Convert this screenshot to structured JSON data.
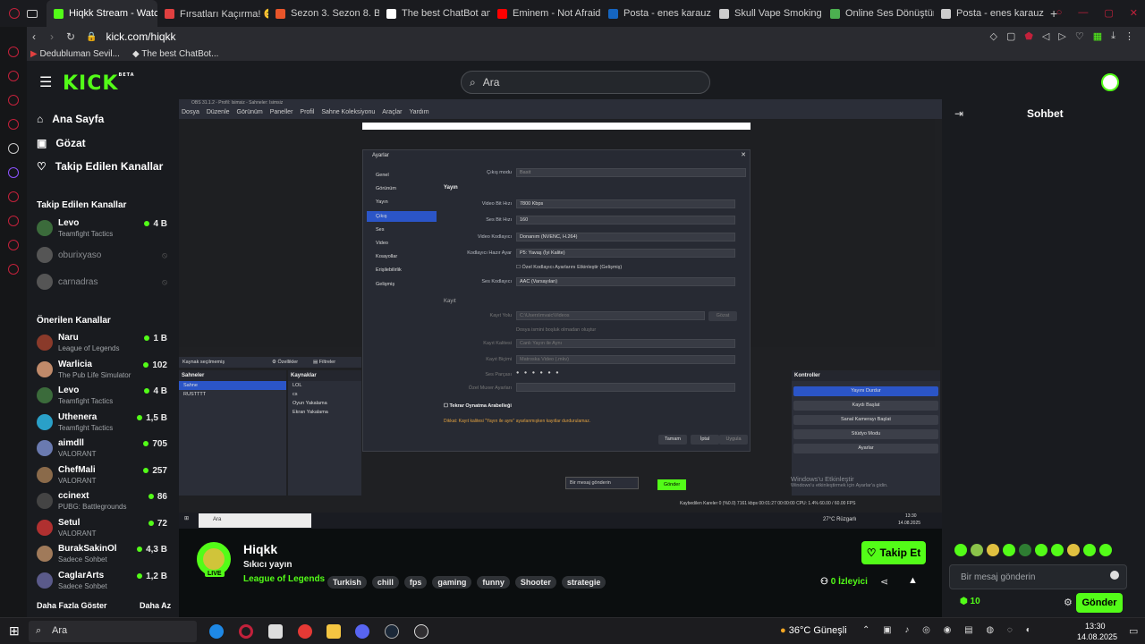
{
  "browser": {
    "tabs": [
      {
        "label": "Hiqkk Stream - Watch Live",
        "color": "#53fc18",
        "active": true
      },
      {
        "label": "Fırsatları Kaçırma! 😊",
        "color": "#e04040"
      },
      {
        "label": "Sezon 3. Sezon 8. Bölüm",
        "color": "#e8552a"
      },
      {
        "label": "The best ChatBot and W",
        "color": "#ffffff"
      },
      {
        "label": "Eminem - Not Afraid - Y",
        "color": "#ff0000"
      },
      {
        "label": "Posta - enes karauz - O",
        "color": "#1565c0"
      },
      {
        "label": "Skull Vape Smoking Log",
        "color": "#cccccc"
      },
      {
        "label": "Online Ses Dönüştürücü",
        "color": "#4caf50"
      },
      {
        "label": "Posta - enes karauz - O",
        "color": "#cccccc"
      }
    ],
    "url": "kick.com/hiqkk",
    "bookmarks": [
      "Dedubluman Sevil...",
      "The best ChatBot..."
    ]
  },
  "kick": {
    "logo": "KICK",
    "logo_badge": "BETA",
    "search_placeholder": "Ara",
    "nav": [
      {
        "label": "Ana Sayfa",
        "icon": "home-icon",
        "glyph": "⌂"
      },
      {
        "label": "Gözat",
        "icon": "browse-icon",
        "glyph": "▣"
      },
      {
        "label": "Takip Edilen Kanallar",
        "icon": "heart-icon",
        "glyph": "♡"
      }
    ],
    "followed_title": "Takip Edilen Kanallar",
    "followed": [
      {
        "name": "Levo",
        "game": "Teamfight Tactics",
        "viewers": "4 B",
        "color": "#3b6b3b"
      },
      {
        "name": "oburixyaso",
        "game": "",
        "viewers": "",
        "color": "#555",
        "offline": true
      },
      {
        "name": "carnadras",
        "game": "",
        "viewers": "",
        "color": "#555",
        "offline": true
      }
    ],
    "recommended_title": "Önerilen Kanallar",
    "recommended": [
      {
        "name": "Naru",
        "game": "League of Legends",
        "viewers": "1 B",
        "color": "#8a3a2a"
      },
      {
        "name": "Warlicia",
        "game": "The Pub Life Simulator",
        "viewers": "102",
        "color": "#c08a6a"
      },
      {
        "name": "Levo",
        "game": "Teamfight Tactics",
        "viewers": "4 B",
        "color": "#3b6b3b"
      },
      {
        "name": "Uthenera",
        "game": "Teamfight Tactics",
        "viewers": "1,5 B",
        "color": "#2aa0c8"
      },
      {
        "name": "aimdll",
        "game": "VALORANT",
        "viewers": "705",
        "color": "#6a7ab0"
      },
      {
        "name": "ChefMali",
        "game": "VALORANT",
        "viewers": "257",
        "color": "#8a6a4a"
      },
      {
        "name": "ccinext",
        "game": "PUBG: Battlegrounds",
        "viewers": "86",
        "color": "#444"
      },
      {
        "name": "Setul",
        "game": "VALORANT",
        "viewers": "72",
        "color": "#b03030"
      },
      {
        "name": "BurakSakinOl",
        "game": "Sadece Sohbet",
        "viewers": "4,3 B",
        "color": "#a07a5a"
      },
      {
        "name": "CaglarArts",
        "game": "Sadece Sohbet",
        "viewers": "1,2 B",
        "color": "#5a5a8a"
      }
    ],
    "show_more": "Daha Fazla Göster",
    "show_less": "Daha Az",
    "chat_title": "Sohbet",
    "chat_placeholder": "Bir mesaj gönderin",
    "chat_send": "Gönder",
    "chat_points": "10",
    "streamer": {
      "name": "Hiqkk",
      "title": "Sıkıcı yayın",
      "category": "League of Legends",
      "live_badge": "LIVE",
      "tags": [
        "Turkish",
        "chill",
        "fps",
        "gaming",
        "funny",
        "Shooter",
        "strategie"
      ],
      "viewers_count": "0",
      "viewers_label": "İzleyici",
      "follow_label": "Takip Et"
    }
  },
  "obs": {
    "title": "OBS 31.1.2 - Profil: Isimsiz - Sahneler: Isimsiz",
    "menu": [
      "Dosya",
      "Düzenle",
      "Görünüm",
      "Paneller",
      "Profil",
      "Sahne Koleksiyonu",
      "Araçlar",
      "Yardım"
    ],
    "settings_title": "Ayarlar",
    "settings_tabs": [
      "Genel",
      "Görünüm",
      "Yayın",
      "Çıkış",
      "Ses",
      "Video",
      "Kısayollar",
      "Erişilebilirlik",
      "Gelişmiş"
    ],
    "output_mode_label": "Çıkış modu",
    "output_mode_value": "Basit",
    "stream_section": "Yayın",
    "rows": [
      {
        "label": "Video Bit Hızı",
        "value": "7800 Kbps"
      },
      {
        "label": "Ses Bit Hızı",
        "value": "160"
      },
      {
        "label": "Video Kodlayıcı",
        "value": "Donanım (NVENC, H.264)"
      },
      {
        "label": "Kodlayıcı Hazır Ayar",
        "value": "P5: Yavaş (İyi Kalite)"
      },
      {
        "label": "Ses Kodlayıcı",
        "value": "AAC (Varsayılan)"
      }
    ],
    "custom_encoder": "Özel Kodlayıcı Ayarlarını Etkinleştir (Gelişmiş)",
    "record_section": "Kayıt",
    "record_path_label": "Kayıt Yolu",
    "record_path_value": "C:\\Users\\mvaic\\Videos",
    "browse": "Gözat",
    "no_space": "Dosya ismini boşluk olmadan oluştur",
    "record_quality_label": "Kayıt Kalitesi",
    "record_quality_value": "Canlı Yayın ile Aynı",
    "record_format_label": "Kayıt Biçimi",
    "record_format_value": "Matroska Video (.mkv)",
    "audio_track_label": "Ses Parçası",
    "custom_muxer_label": "Özel Muxer Ayarları",
    "replay_buffer": "Tekrar Oynatma Arabelleği",
    "warning": "Dikkat: Kayıt kalitesi \"Yayın ile aynı\" ayarlanmışken kayıtlar durdurulamaz.",
    "ok": "Tamam",
    "cancel": "İptal",
    "apply": "Uygula",
    "scenes_title": "Sahneler",
    "scenes": [
      "Sahne",
      "RUSTTTT"
    ],
    "sources_title": "Kaynaklar",
    "sources": [
      "LOL",
      "cs",
      "Oyun Yakalama",
      "Ekran Yakalama"
    ],
    "source_none": "Kaynak seçilmemiş",
    "props": "Özellikler",
    "filters": "Filtreler",
    "controls_title": "Kontroller",
    "controls": [
      "Yayını Durdur",
      "Kaydı Başlat",
      "Sanal Kamerayı Başlat",
      "Stüdyo Modu",
      "Ayarlar"
    ],
    "chat_placeholder": "Bir mesaj gönderin",
    "chat_send": "Gönder",
    "win_activate": "Windows'u Etkinleştir",
    "win_activate_sub": "Windows'u etkinleştirmek için Ayarlar'a gidin.",
    "status": "Kaybedilen Kareler 0 (%0.0)   7161 kbps   00:01:27   00:00:00   CPU: 1.4%   60.00 / 60.00 FPS",
    "inner_taskbar_search": "Ara",
    "inner_weather": "27°C Rüzgarlı",
    "inner_time": "13:30",
    "inner_date": "14.08.2025"
  },
  "taskbar": {
    "search": "Ara",
    "weather": "36°C Güneşli",
    "time": "13:30",
    "date": "14.08.2025"
  }
}
